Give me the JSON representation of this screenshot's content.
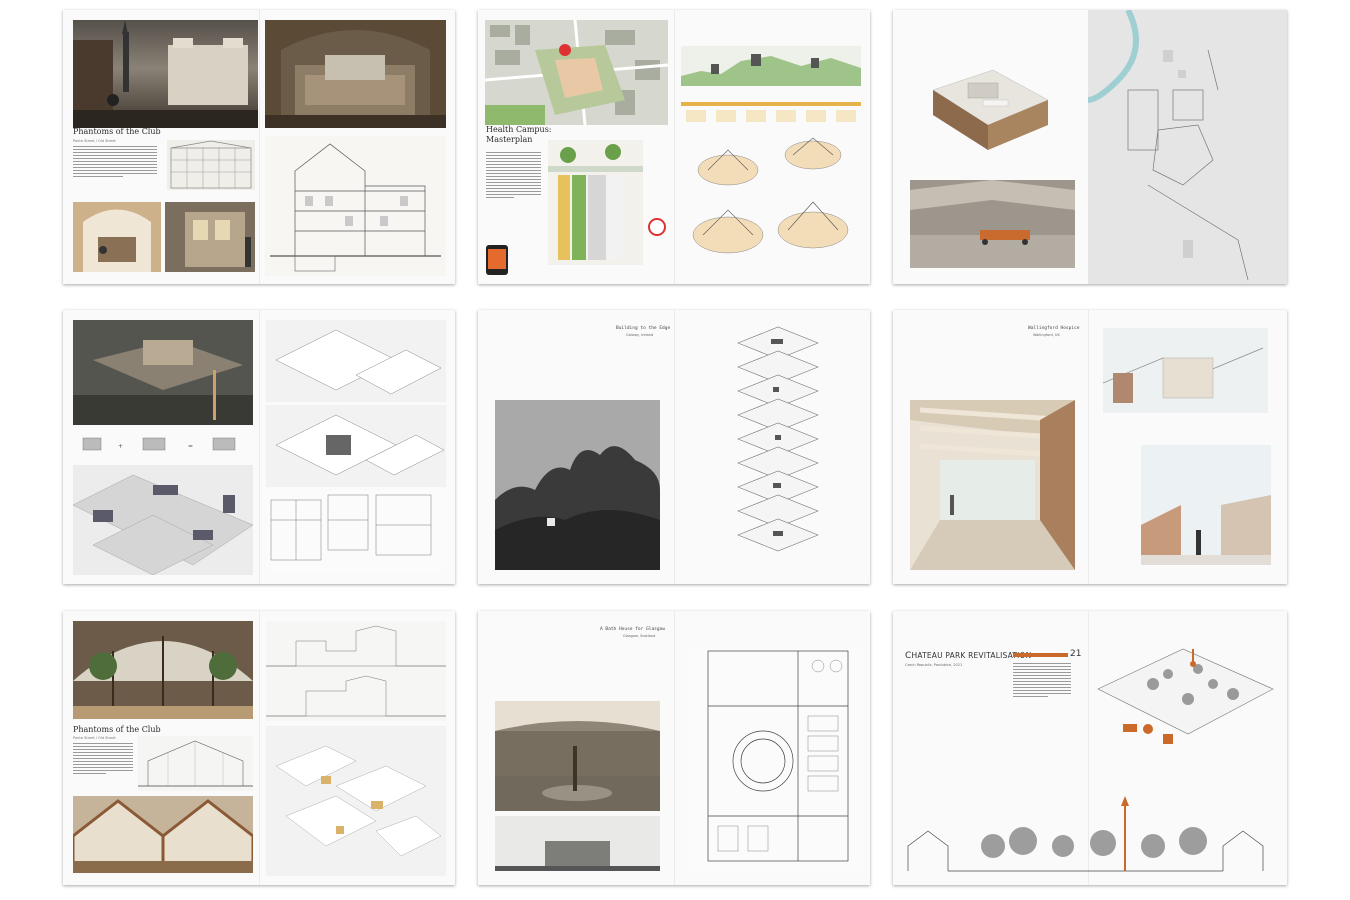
{
  "spreads": [
    {
      "name": "phantoms-club-spread-1",
      "title": "Phantoms of the Club",
      "subtitle": "Ponte Street / Old Street"
    },
    {
      "name": "health-campus-spread",
      "title_line1": "Health Campus:",
      "title_line2": "Masterplan"
    },
    {
      "name": "model-site-spread"
    },
    {
      "name": "phantoms-club-spread-2"
    },
    {
      "name": "building-edge-spread",
      "title": "Building to the Edge",
      "subtitle": "Galway, Ireland"
    },
    {
      "name": "wallingford-spread",
      "title": "Wallingford Hospice",
      "subtitle": "Wallingford, UK"
    },
    {
      "name": "phantoms-club-spread-3",
      "title": "Phantoms of the Club",
      "subtitle": "Ponte Street / Old Street"
    },
    {
      "name": "bath-house-spread",
      "title": "A Bath House for Glasgow",
      "subtitle": "Glasgow, Scotland"
    },
    {
      "name": "chateau-park-spread",
      "title_first": "C",
      "title_rest": "HATEAU PARK REVITALISATION",
      "subtitle": "Czech Republic, Pardubice, 2021",
      "page_number": "21"
    }
  ],
  "colors": {
    "accent_orange": "#c9692a",
    "dark_render": "#3d3a33",
    "drawing_gray": "#cfcfcf"
  }
}
